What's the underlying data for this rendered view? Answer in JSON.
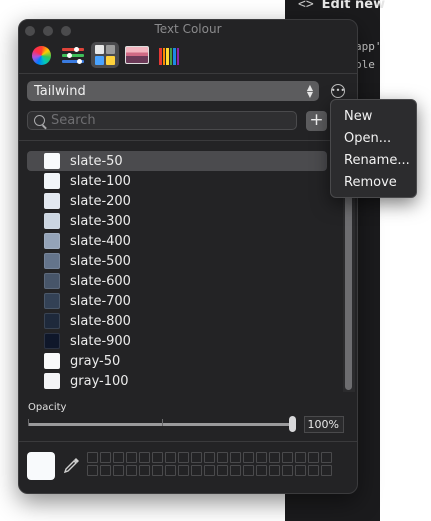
{
  "editor": {
    "title_prefix": "<>",
    "title": "Edit new",
    "code_lines": [
      "app'",
      "ble"
    ]
  },
  "window": {
    "title": "Text Colour",
    "modes": [
      {
        "icon": "color-wheel-icon",
        "label": "Color Wheel"
      },
      {
        "icon": "color-sliders-icon",
        "label": "Color Sliders"
      },
      {
        "icon": "color-palettes-icon",
        "label": "Color Palettes",
        "active": true
      },
      {
        "icon": "image-palettes-icon",
        "label": "Image Palettes"
      },
      {
        "icon": "pencils-icon",
        "label": "Pencils"
      }
    ]
  },
  "palette": {
    "selected": "Tailwind",
    "more_icon": "ellipsis-circle-icon"
  },
  "search": {
    "placeholder": "Search",
    "value": ""
  },
  "add_label": "+",
  "colors": [
    {
      "name": "slate-50",
      "hex": "#f8fafc",
      "selected": true
    },
    {
      "name": "slate-100",
      "hex": "#f1f5f9"
    },
    {
      "name": "slate-200",
      "hex": "#e2e8f0"
    },
    {
      "name": "slate-300",
      "hex": "#cbd5e1"
    },
    {
      "name": "slate-400",
      "hex": "#94a3b8"
    },
    {
      "name": "slate-500",
      "hex": "#64748b"
    },
    {
      "name": "slate-600",
      "hex": "#475569"
    },
    {
      "name": "slate-700",
      "hex": "#334155"
    },
    {
      "name": "slate-800",
      "hex": "#1e293b"
    },
    {
      "name": "slate-900",
      "hex": "#0f172a"
    },
    {
      "name": "gray-50",
      "hex": "#f9fafb"
    },
    {
      "name": "gray-100",
      "hex": "#f3f4f6"
    }
  ],
  "opacity": {
    "label": "Opacity",
    "value_text": "100%",
    "value": 1.0
  },
  "current_color": "#f8fafc",
  "menu": {
    "items": [
      "New",
      "Open...",
      "Rename...",
      "Remove"
    ]
  }
}
